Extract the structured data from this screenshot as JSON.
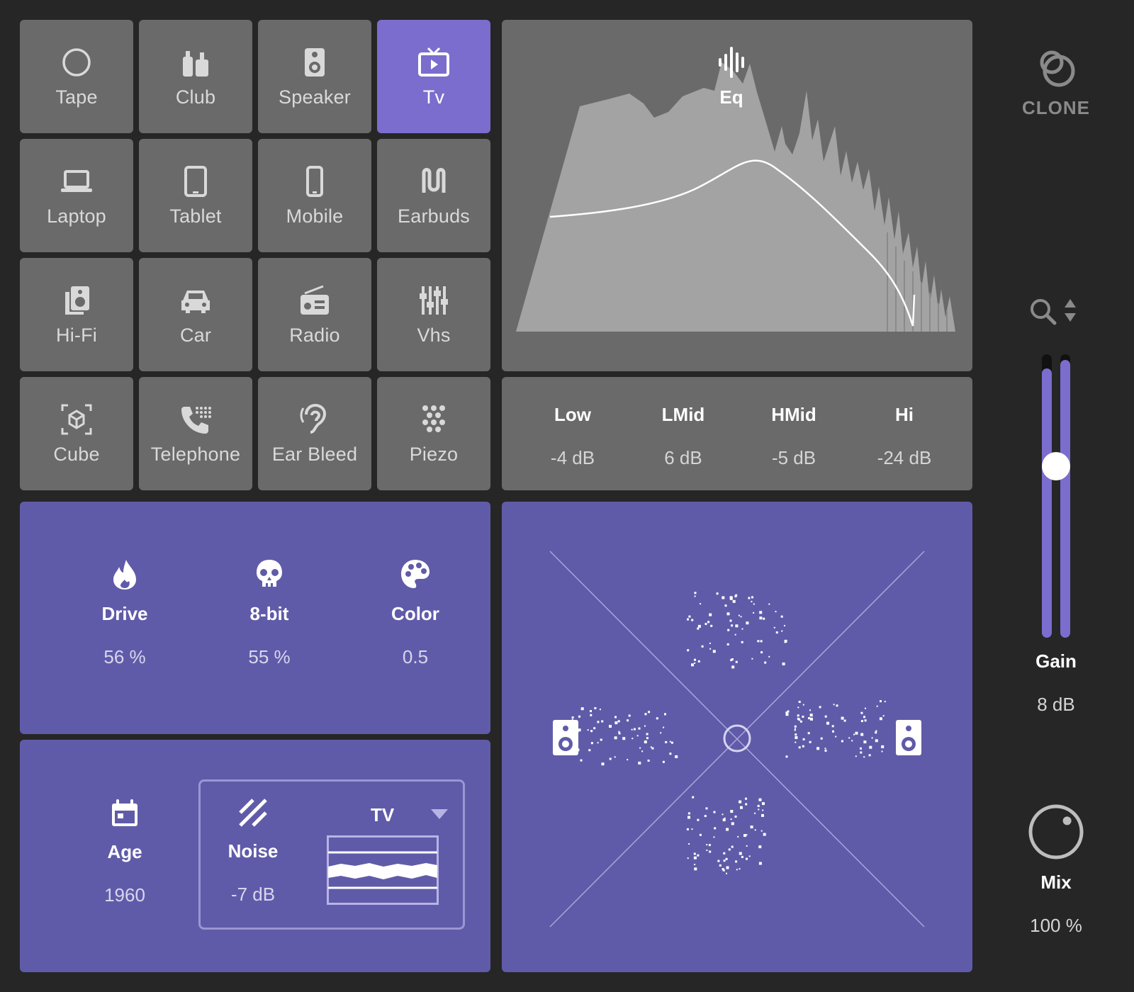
{
  "presets": [
    {
      "label": "Tape",
      "icon": "circle-icon"
    },
    {
      "label": "Club",
      "icon": "bottles-icon"
    },
    {
      "label": "Speaker",
      "icon": "speaker-icon"
    },
    {
      "label": "Tv",
      "icon": "tv-icon",
      "active": true
    },
    {
      "label": "Laptop",
      "icon": "laptop-icon"
    },
    {
      "label": "Tablet",
      "icon": "tablet-icon"
    },
    {
      "label": "Mobile",
      "icon": "mobile-icon"
    },
    {
      "label": "Earbuds",
      "icon": "earbuds-icon"
    },
    {
      "label": "Hi-Fi",
      "icon": "hifi-icon"
    },
    {
      "label": "Car",
      "icon": "car-icon"
    },
    {
      "label": "Radio",
      "icon": "radio-icon"
    },
    {
      "label": "Vhs",
      "icon": "sliders-icon"
    },
    {
      "label": "Cube",
      "icon": "cube-icon"
    },
    {
      "label": "Telephone",
      "icon": "telephone-icon"
    },
    {
      "label": "Ear Bleed",
      "icon": "ear-icon"
    },
    {
      "label": "Piezo",
      "icon": "dots-icon"
    }
  ],
  "eq": {
    "title": "Eq",
    "bands": [
      {
        "name": "Low",
        "value": "-4 dB"
      },
      {
        "name": "LMid",
        "value": "6 dB"
      },
      {
        "name": "HMid",
        "value": "-5 dB"
      },
      {
        "name": "Hi",
        "value": "-24 dB"
      }
    ]
  },
  "effects": [
    {
      "name": "Drive",
      "value": "56 %",
      "icon": "flame-icon"
    },
    {
      "name": "8-bit",
      "value": "55 %",
      "icon": "skull-icon"
    },
    {
      "name": "Color",
      "value": "0.5",
      "icon": "palette-icon"
    }
  ],
  "age": {
    "name": "Age",
    "value": "1960",
    "icon": "calendar-icon"
  },
  "noise": {
    "name": "Noise",
    "value": "-7 dB",
    "type": "TV",
    "icon": "noise-stripes-icon"
  },
  "brand": {
    "name": "CLONE"
  },
  "gain": {
    "label": "Gain",
    "value": "8 dB",
    "level": 0.55
  },
  "mix": {
    "label": "Mix",
    "value": "100 %",
    "level": 1.0
  },
  "colors": {
    "accent": "#7b6dcd",
    "panel_purple": "#605ba8",
    "tile": "#6a6a6a",
    "background": "#262626"
  }
}
